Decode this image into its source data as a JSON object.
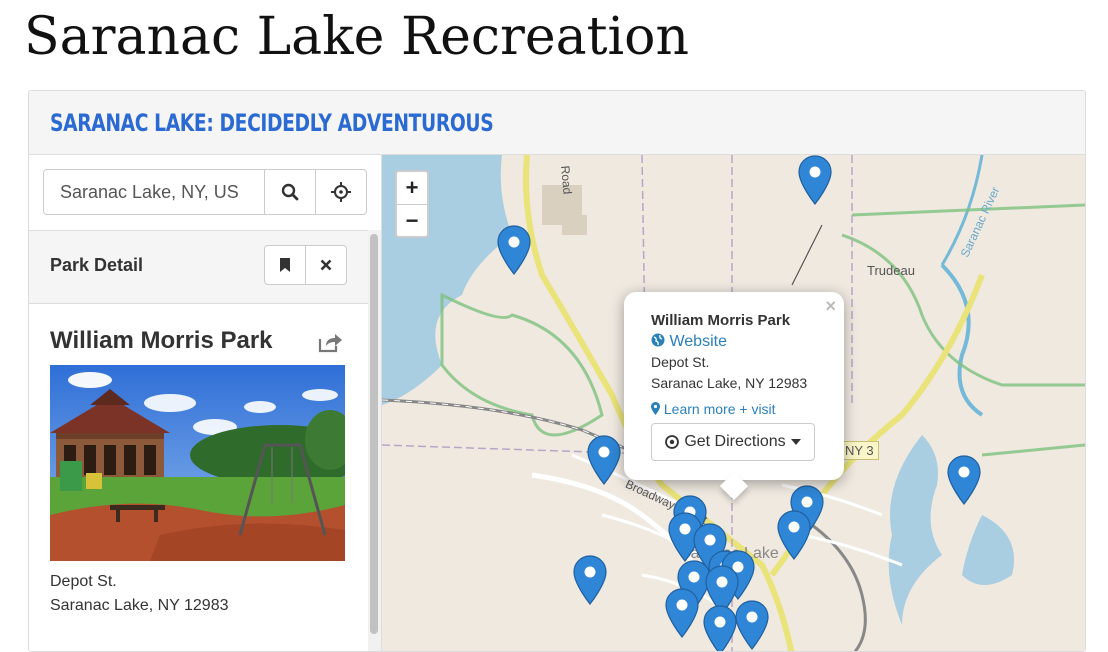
{
  "page": {
    "title": "Saranac Lake Recreation"
  },
  "widget": {
    "brand": "Saranac Lake: Decidedly Adventurous"
  },
  "search": {
    "value": "Saranac Lake, NY, US",
    "search_icon": "search-icon",
    "locate_icon": "crosshairs-icon"
  },
  "detail": {
    "header": "Park Detail",
    "park_name": "William Morris Park",
    "address_line1": "Depot St.",
    "address_line2": "Saranac Lake, NY 12983"
  },
  "map": {
    "zoom_in": "+",
    "zoom_out": "−",
    "labels": {
      "trudeau": "Trudeau",
      "road": "Road",
      "broadway": "Broadway Street",
      "river": "Saranac River",
      "town": "Saranac Lake",
      "route": "NY 3"
    },
    "popup": {
      "close": "×",
      "title": "William Morris Park",
      "website": "Website",
      "line1": "Depot St.",
      "line2": "Saranac Lake, NY 12983",
      "learn_more": "Learn more + visit",
      "directions": "Get Directions"
    }
  },
  "colors": {
    "brand": "#2a6ad2",
    "pin": "#2f86d6",
    "link": "#2a80b9",
    "water": "#a9cde1",
    "park": "#7ec07e"
  }
}
